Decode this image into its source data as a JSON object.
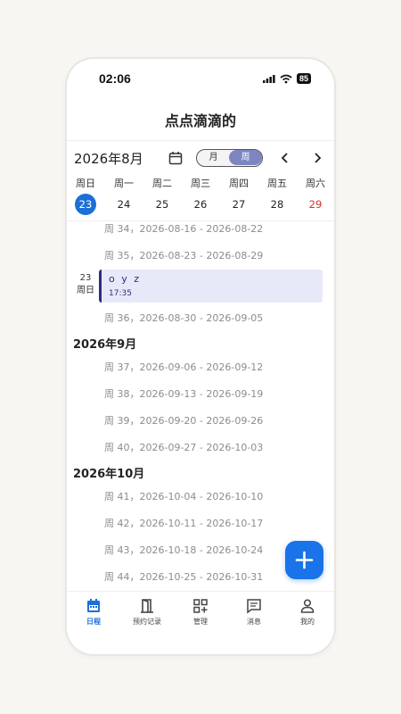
{
  "status_bar": {
    "time": "02:06",
    "battery": "85"
  },
  "app": {
    "title": "点点滴滴的"
  },
  "calendar": {
    "month_label": "2026年8月",
    "view_toggle": {
      "month": "月",
      "week": "周",
      "selected": "周"
    },
    "weekdays": [
      "周日",
      "周一",
      "周二",
      "周三",
      "周四",
      "周五",
      "周六"
    ],
    "dates": [
      "23",
      "24",
      "25",
      "26",
      "27",
      "28",
      "29"
    ],
    "selected_date": "23"
  },
  "schedule": {
    "rows": [
      {
        "type": "week",
        "text": "周 34，2026-08-16 - 2026-08-22"
      },
      {
        "type": "week",
        "text": "周 35，2026-08-23 - 2026-08-29"
      },
      {
        "type": "event",
        "day": "23",
        "weekday": "周日",
        "title": "o y z",
        "time": "17:35"
      },
      {
        "type": "week",
        "text": "周 36，2026-08-30 - 2026-09-05"
      },
      {
        "type": "month",
        "text": "2026年9月"
      },
      {
        "type": "week",
        "text": "周 37，2026-09-06 - 2026-09-12"
      },
      {
        "type": "week",
        "text": "周 38，2026-09-13 - 2026-09-19"
      },
      {
        "type": "week",
        "text": "周 39，2026-09-20 - 2026-09-26"
      },
      {
        "type": "week",
        "text": "周 40，2026-09-27 - 2026-10-03"
      },
      {
        "type": "month",
        "text": "2026年10月"
      },
      {
        "type": "week",
        "text": "周 41，2026-10-04 - 2026-10-10"
      },
      {
        "type": "week",
        "text": "周 42，2026-10-11 - 2026-10-17"
      },
      {
        "type": "week",
        "text": "周 43，2026-10-18 - 2026-10-24"
      },
      {
        "type": "week",
        "text": "周 44，2026-10-25 - 2026-10-31"
      }
    ]
  },
  "tabs": [
    {
      "label": "日程",
      "icon": "calendar-icon",
      "active": true
    },
    {
      "label": "预约记录",
      "icon": "door-icon",
      "active": false
    },
    {
      "label": "管理",
      "icon": "grid-plus-icon",
      "active": false
    },
    {
      "label": "消息",
      "icon": "message-icon",
      "active": false
    },
    {
      "label": "我的",
      "icon": "person-icon",
      "active": false
    }
  ],
  "colors": {
    "accent": "#1d6fd8",
    "event_bg": "#e8e9f8",
    "event_border": "#2b2f7e",
    "weekend": "#d6322a"
  }
}
